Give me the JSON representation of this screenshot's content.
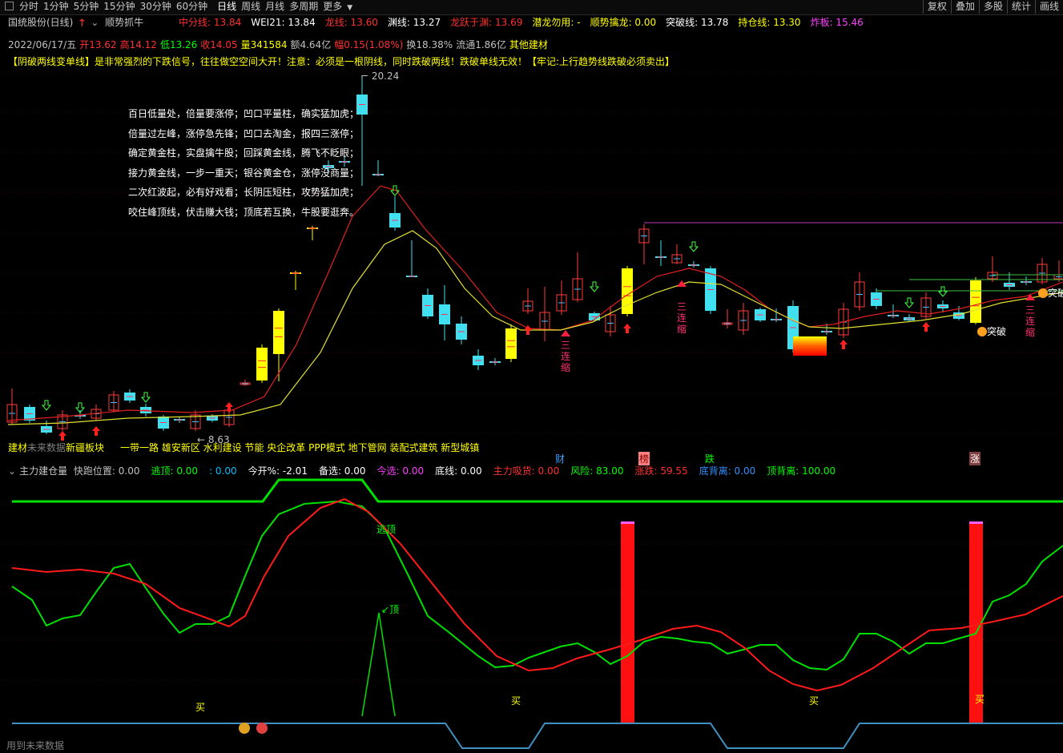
{
  "toolbar": {
    "periods": [
      "分时",
      "1分钟",
      "5分钟",
      "15分钟",
      "30分钟",
      "60分钟",
      "日线",
      "周线",
      "月线",
      "多周期",
      "更多"
    ],
    "active": "日线",
    "right_buttons": [
      "复权",
      "叠加",
      "多股",
      "统计",
      "画线"
    ]
  },
  "indicator_line": {
    "stock": "国统股份(日线)",
    "strategy": "顺势抓牛",
    "items": [
      {
        "text": "中分线: 13.84",
        "color": "#ff3030"
      },
      {
        "text": "WEI21: 13.84",
        "color": "#ffffff"
      },
      {
        "text": "龙线: 13.60",
        "color": "#ff3030"
      },
      {
        "text": "渊线: 13.27",
        "color": "#ffffff"
      },
      {
        "text": "龙跃于渊: 13.69",
        "color": "#ff3030"
      },
      {
        "text": "潜龙勿用: -",
        "color": "#ffff00"
      },
      {
        "text": "顺势擒龙: 0.00",
        "color": "#ffff00"
      },
      {
        "text": "突破线: 13.78",
        "color": "#ffffff"
      },
      {
        "text": "持仓线: 13.30",
        "color": "#ffff00"
      },
      {
        "text": "炸板: 15.46",
        "color": "#ff40ff"
      }
    ]
  },
  "quote_line": {
    "date": "2022/06/17/五",
    "open": "开13.62",
    "high": "高14.12",
    "low": "低13.26",
    "close": "收14.05",
    "vol": "量341584",
    "amount": "额4.64亿",
    "amp": "幅0.15(1.08%)",
    "turn": "换18.38%",
    "float": "流通1.86亿",
    "sector": "其他建材"
  },
  "warning": "【阴破两线变单线】是非常强烈的下跌信号，往往做空空间大开！注意：必须是一根阴线，同时跌破两线！跌破单线无效！【牢记:上行趋势线跌破必须卖出】",
  "poem": [
    "百日低量处，倍量要涨停；凹口平量柱，确实猛加虎；",
    "倍量过左峰，涨停急先锋；凹口去淘金，报四三涨停；",
    "确定黄金柱，实盘擒牛股；回踩黄金线，腾飞不眨眼；",
    "接力黄金线，一步一重天；银谷黄金仓，涨停没商量；",
    "二次红波起，必有好戏看；长阴压短柱，攻势猛加虎；",
    "咬住峰顶线，伏击赚大钱；顶底若互换，牛股要逛奔。"
  ],
  "price_labels": {
    "high": "20.24",
    "low": "8.63"
  },
  "signals": {
    "break": "突破",
    "three1": "三连缩",
    "three2": "三连缩",
    "three3": "三连缩"
  },
  "concepts": {
    "first": "建材",
    "future": "未来数据",
    "xinjiang": "新疆板块",
    "rest": "一带一路 雄安新区 水利建设 节能 央企改革 PPP模式 地下管网 装配式建筑 新型城镇"
  },
  "event_labels": [
    "财",
    "榜",
    "跌",
    "涨"
  ],
  "sub_line": {
    "name": "主力建仓量",
    "items": [
      {
        "text": "快跑位置: 0.00",
        "color": "#c0c0c0"
      },
      {
        "text": "逃顶: 0.00",
        "color": "#00ff00"
      },
      {
        "text": ": 0.00",
        "color": "#00c0ff"
      },
      {
        "text": "今开%: -2.01",
        "color": "#ffffff"
      },
      {
        "text": "备选: 0.00",
        "color": "#ffffff"
      },
      {
        "text": "今选: 0.00",
        "color": "#ff40ff"
      },
      {
        "text": "底线: 0.00",
        "color": "#ffffff"
      },
      {
        "text": "主力吸货: 0.00",
        "color": "#ff3030"
      },
      {
        "text": "风险: 83.00",
        "color": "#00ff00"
      },
      {
        "text": "涨跌: 59.55",
        "color": "#ff3030"
      },
      {
        "text": "底背离: 0.00",
        "color": "#3090ff"
      },
      {
        "text": "顶背离: 100.00",
        "color": "#00ff00"
      }
    ]
  },
  "sub_labels": {
    "escape": "逃顶",
    "top": "顶",
    "buy": "买"
  },
  "footer": "用到未来数据",
  "colors": {
    "up": "#ff3c3c",
    "down": "#40e0f0",
    "yellow": "#ffff00",
    "green": "#00ff00"
  }
}
